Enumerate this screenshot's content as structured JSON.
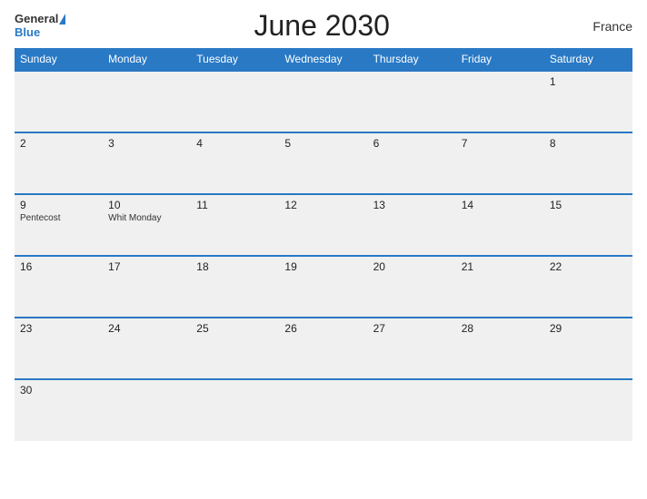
{
  "header": {
    "title": "June 2030",
    "country": "France",
    "logo_general": "General",
    "logo_blue": "Blue"
  },
  "weekdays": [
    "Sunday",
    "Monday",
    "Tuesday",
    "Wednesday",
    "Thursday",
    "Friday",
    "Saturday"
  ],
  "weeks": [
    [
      {
        "day": "",
        "holiday": ""
      },
      {
        "day": "",
        "holiday": ""
      },
      {
        "day": "",
        "holiday": ""
      },
      {
        "day": "",
        "holiday": ""
      },
      {
        "day": "",
        "holiday": ""
      },
      {
        "day": "",
        "holiday": ""
      },
      {
        "day": "1",
        "holiday": ""
      }
    ],
    [
      {
        "day": "2",
        "holiday": ""
      },
      {
        "day": "3",
        "holiday": ""
      },
      {
        "day": "4",
        "holiday": ""
      },
      {
        "day": "5",
        "holiday": ""
      },
      {
        "day": "6",
        "holiday": ""
      },
      {
        "day": "7",
        "holiday": ""
      },
      {
        "day": "8",
        "holiday": ""
      }
    ],
    [
      {
        "day": "9",
        "holiday": "Pentecost"
      },
      {
        "day": "10",
        "holiday": "Whit Monday"
      },
      {
        "day": "11",
        "holiday": ""
      },
      {
        "day": "12",
        "holiday": ""
      },
      {
        "day": "13",
        "holiday": ""
      },
      {
        "day": "14",
        "holiday": ""
      },
      {
        "day": "15",
        "holiday": ""
      }
    ],
    [
      {
        "day": "16",
        "holiday": ""
      },
      {
        "day": "17",
        "holiday": ""
      },
      {
        "day": "18",
        "holiday": ""
      },
      {
        "day": "19",
        "holiday": ""
      },
      {
        "day": "20",
        "holiday": ""
      },
      {
        "day": "21",
        "holiday": ""
      },
      {
        "day": "22",
        "holiday": ""
      }
    ],
    [
      {
        "day": "23",
        "holiday": ""
      },
      {
        "day": "24",
        "holiday": ""
      },
      {
        "day": "25",
        "holiday": ""
      },
      {
        "day": "26",
        "holiday": ""
      },
      {
        "day": "27",
        "holiday": ""
      },
      {
        "day": "28",
        "holiday": ""
      },
      {
        "day": "29",
        "holiday": ""
      }
    ],
    [
      {
        "day": "30",
        "holiday": ""
      },
      {
        "day": "",
        "holiday": ""
      },
      {
        "day": "",
        "holiday": ""
      },
      {
        "day": "",
        "holiday": ""
      },
      {
        "day": "",
        "holiday": ""
      },
      {
        "day": "",
        "holiday": ""
      },
      {
        "day": "",
        "holiday": ""
      }
    ]
  ],
  "colors": {
    "header_bg": "#2979c5",
    "row_border": "#2979c5",
    "cell_bg": "#f0f0f0"
  }
}
